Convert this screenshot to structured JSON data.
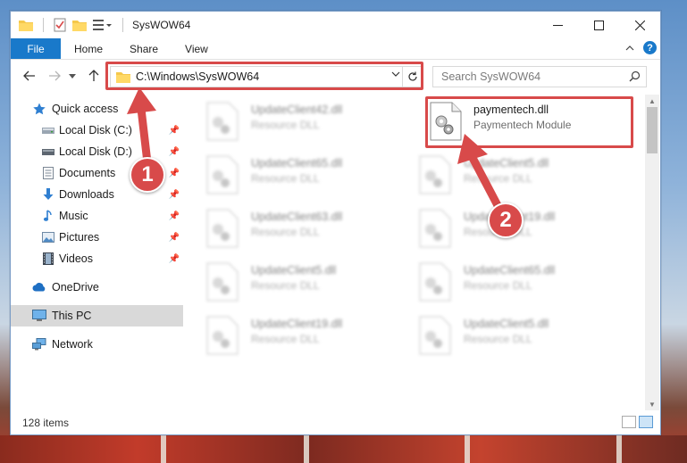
{
  "window": {
    "title": "SysWOW64"
  },
  "ribbon": {
    "tabs": [
      "File",
      "Home",
      "Share",
      "View"
    ]
  },
  "address": {
    "path": "C:\\Windows\\SysWOW64"
  },
  "search": {
    "placeholder": "Search SysWOW64"
  },
  "nav": {
    "quick_access": "Quick access",
    "items": [
      {
        "label": "Local Disk (C:)",
        "icon": "drive-icon"
      },
      {
        "label": "Local Disk (D:)",
        "icon": "drive-icon"
      },
      {
        "label": "Documents",
        "icon": "documents-icon"
      },
      {
        "label": "Downloads",
        "icon": "downloads-icon"
      },
      {
        "label": "Music",
        "icon": "music-icon"
      },
      {
        "label": "Pictures",
        "icon": "pictures-icon"
      },
      {
        "label": "Videos",
        "icon": "videos-icon"
      }
    ],
    "onedrive": "OneDrive",
    "this_pc": "This PC",
    "network": "Network"
  },
  "files": {
    "left": [
      {
        "name": "UpdateClient42.dll",
        "type": "Resource DLL"
      },
      {
        "name": "UpdateClient65.dll",
        "type": "Resource DLL"
      },
      {
        "name": "UpdateClient63.dll",
        "type": "Resource DLL"
      },
      {
        "name": "UpdateClient5.dll",
        "type": "Resource DLL"
      },
      {
        "name": "UpdateClient19.dll",
        "type": "Resource DLL"
      }
    ],
    "right": [
      {
        "name": "paymentech.dll",
        "type": "Paymentech Module"
      },
      {
        "name": "UpdateClient5.dll",
        "type": "Resource DLL"
      },
      {
        "name": "UpdateClient19.dll",
        "type": "Resource DLL"
      },
      {
        "name": "UpdateClient65.dll",
        "type": "Resource DLL"
      },
      {
        "name": "UpdateClient5.dll",
        "type": "Resource DLL"
      }
    ]
  },
  "status": {
    "item_count": "128 items"
  },
  "callouts": [
    "1",
    "2"
  ],
  "colors": {
    "accent": "#1979ca",
    "highlight": "#d84a4a"
  }
}
